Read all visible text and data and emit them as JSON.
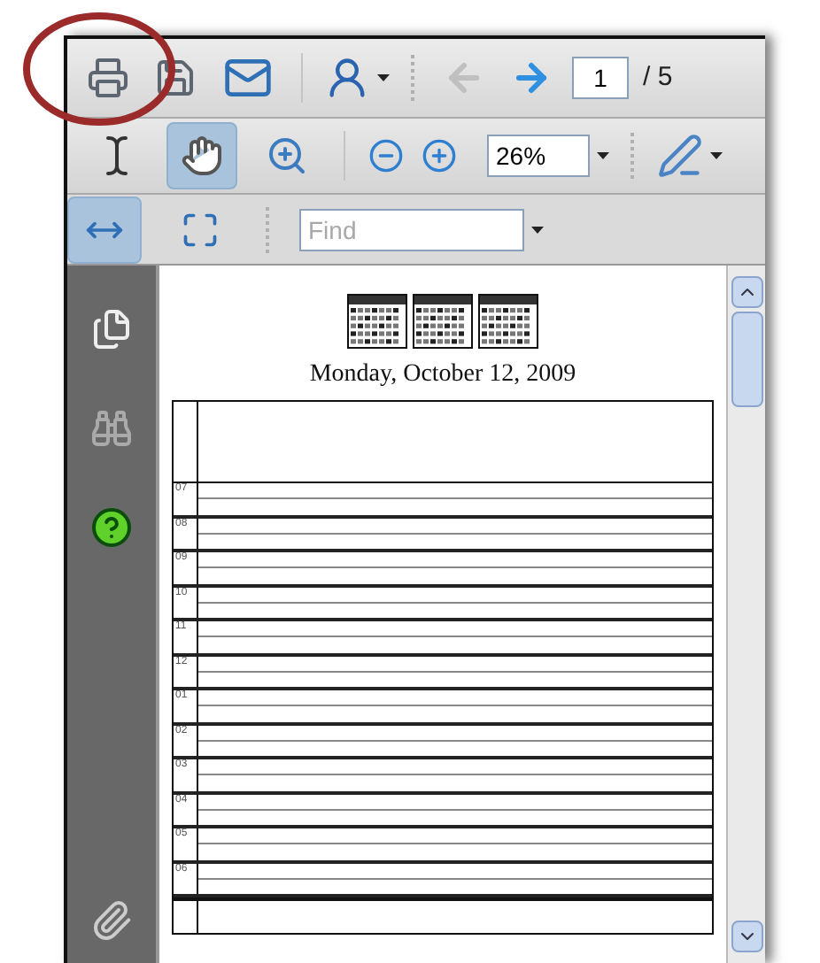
{
  "toolbar_1": {
    "prev_page_disabled": true,
    "next_page_disabled": false,
    "page_number": "1",
    "page_total": "/ 5"
  },
  "toolbar_2": {
    "tools": [
      {
        "kind": "select",
        "selected": false
      },
      {
        "kind": "hand",
        "selected": true
      },
      {
        "kind": "marquee_zoom",
        "selected": false
      }
    ],
    "zoom": "26%"
  },
  "toolbar_3": {
    "views": [
      {
        "kind": "fit_width",
        "selected": true
      },
      {
        "kind": "fit_page",
        "selected": false
      }
    ],
    "find_placeholder": "Find"
  },
  "document": {
    "date": "Monday, October 12, 2009",
    "hours": [
      "07",
      "08",
      "09",
      "10",
      "11",
      "12",
      "01",
      "02",
      "03",
      "04",
      "05",
      "06"
    ]
  }
}
